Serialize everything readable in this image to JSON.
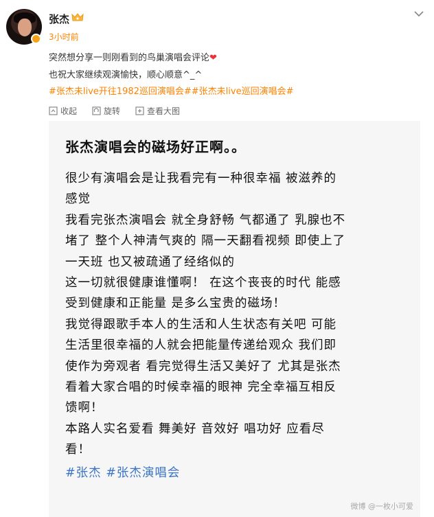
{
  "post": {
    "username": "张杰",
    "time": "3小时前",
    "text_line1": "突然想分享一则刚看到的鸟巢演唱会评论",
    "heart": "❤",
    "text_line2": "也祝大家继续观演愉快，顺心顺意^_^",
    "hashtags": "#张杰未live开往1982巡回演唱会##张杰未live巡回演唱会#"
  },
  "actions": {
    "collect": "收起",
    "rotate": "旋转",
    "view_large": "查看大图"
  },
  "image": {
    "title": "张杰演唱会的磁场好正啊。。",
    "lines": [
      "很少有演唱会是让我看完有一种很幸福 被滋养的",
      "感觉",
      "我看完张杰演唱会 就全身舒畅 气都通了 乳腺也不",
      "堵了 整个人神清气爽的 隔一天翻看视频 即使上了",
      "一天班 也又被疏通了经络似的",
      "这一切就很健康谁懂啊！ 在这个丧丧的时代 能感",
      "受到健康和正能量 是多么宝贵的磁场！",
      "我觉得跟歌手本人的生活和人生状态有关吧 可能",
      "生活里很幸福的人就会把能量传递给观众 我们即",
      "使作为旁观者 看完觉得生活又美好了 尤其是张杰",
      "看着大家合唱的时候幸福的眼神 完全幸福互相反",
      "馈啊！",
      "本路人实名爱看 舞美好 音效好 唱功好 应看尽",
      "看！"
    ],
    "tags": "#张杰 #张杰演唱会",
    "watermark": "微博 @一枚小可爱"
  }
}
